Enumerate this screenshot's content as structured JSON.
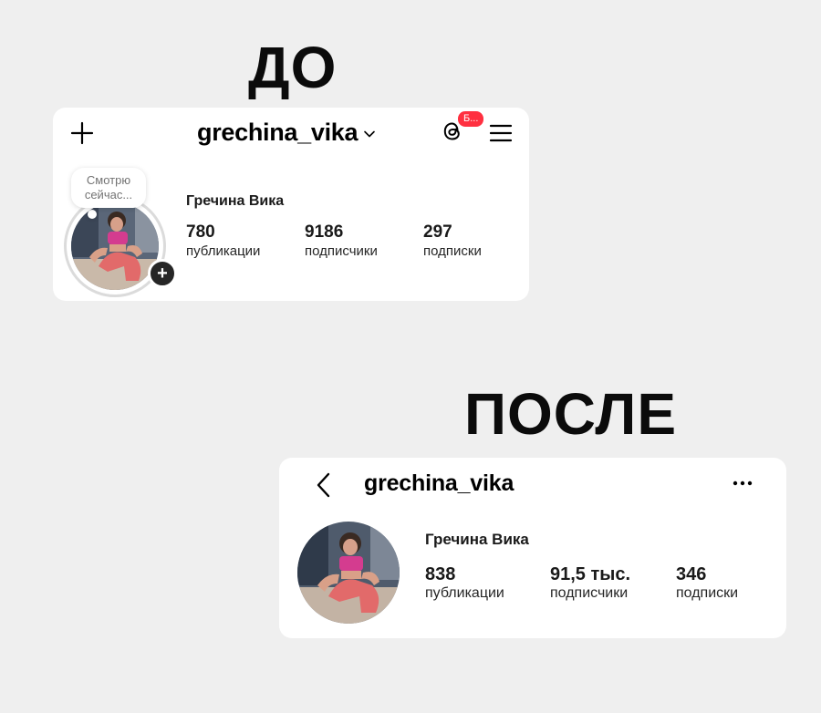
{
  "labels": {
    "before": "ДО",
    "after": "ПОСЛЕ"
  },
  "before_profile": {
    "username": "grechina_vika",
    "notification_badge": "Б...",
    "note_text": "Смотрю сейчас...",
    "full_name": "Гречина Вика",
    "stats": [
      {
        "value": "780",
        "label": "публикации"
      },
      {
        "value": "9186",
        "label": "подписчики"
      },
      {
        "value": "297",
        "label": "подписки"
      }
    ],
    "icons": [
      "plus-icon",
      "chevron-down-icon",
      "threads-icon",
      "menu-icon",
      "add-story-icon"
    ]
  },
  "after_profile": {
    "username": "grechina_vika",
    "full_name": "Гречина Вика",
    "stats": [
      {
        "value": "838",
        "label": "публикации"
      },
      {
        "value": "91,5 тыс.",
        "label": "подписчики"
      },
      {
        "value": "346",
        "label": "подписки"
      }
    ],
    "icons": [
      "back-icon",
      "more-icon"
    ]
  },
  "colors": {
    "background": "#efefef",
    "card": "#ffffff",
    "badge": "#ff3040",
    "text": "#000000",
    "secondary_text": "#737373"
  }
}
